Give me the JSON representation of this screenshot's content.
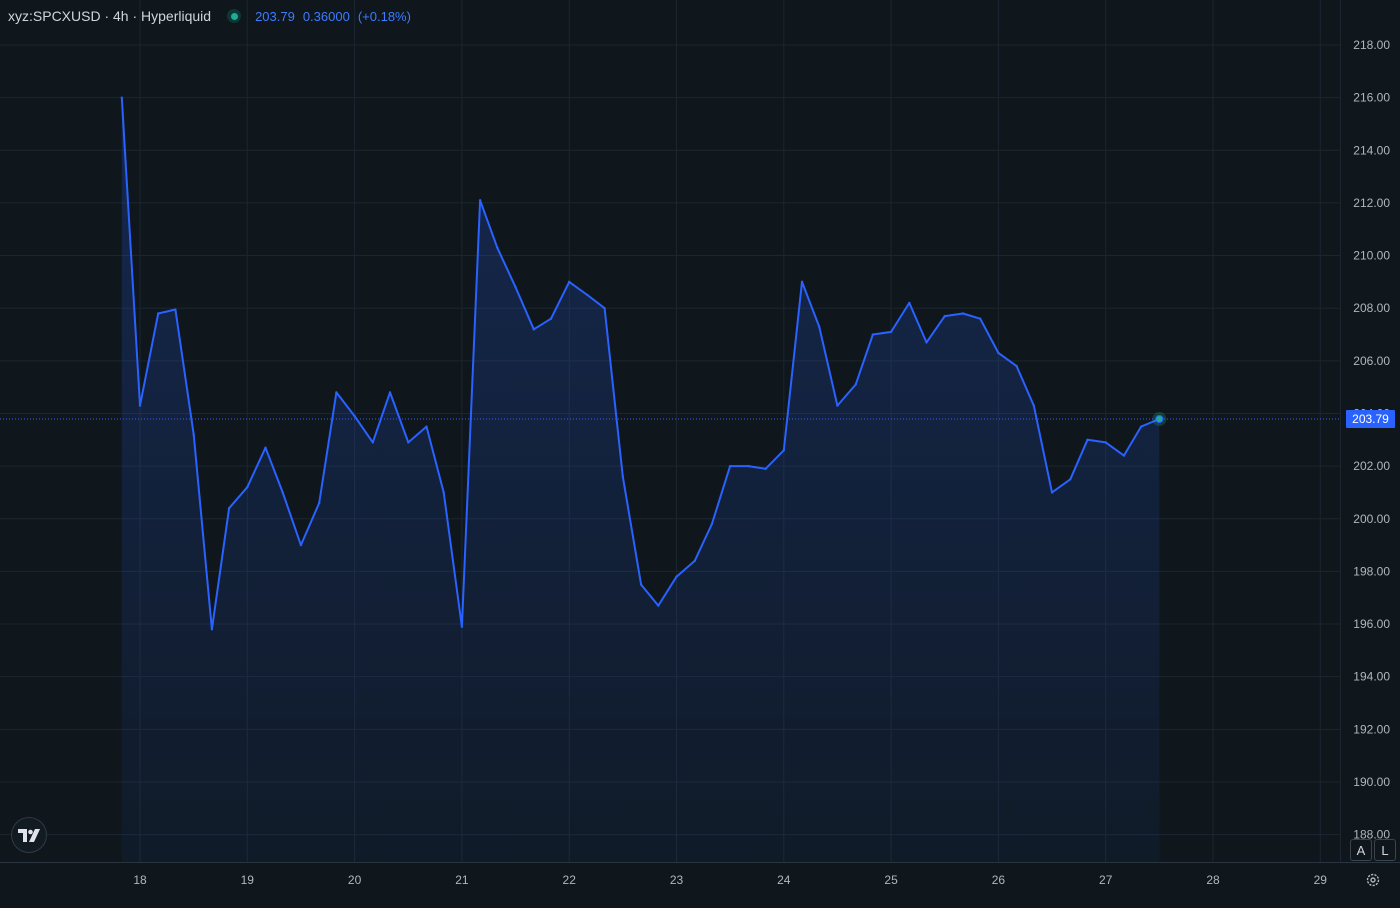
{
  "header": {
    "symbol": "xyz:SPCXUSD · 4h · Hyperliquid",
    "last": "203.79",
    "change": "0.36000",
    "change_pct": "(+0.18%)"
  },
  "price_label": "203.79",
  "buttons": {
    "auto": "A",
    "log": "L"
  },
  "icons": {
    "logo": "tradingview-logo-icon",
    "settings": "gear-icon",
    "status": "market-open-dot-icon"
  },
  "colors": {
    "background": "#0f171d",
    "line": "#2962ff",
    "grid": "#1b2630",
    "text": "#b2b5be",
    "price_tag": "#2962ff"
  },
  "chart_data": {
    "type": "area",
    "x_ticks": [
      "18",
      "19",
      "20",
      "21",
      "22",
      "23",
      "24",
      "25",
      "26",
      "27",
      "28",
      "29"
    ],
    "y_ticks": [
      "218.00",
      "216.00",
      "214.00",
      "212.00",
      "210.00",
      "208.00",
      "206.00",
      "204.00",
      "202.00",
      "200.00",
      "198.00",
      "196.00",
      "194.00",
      "192.00",
      "190.00",
      "188.00"
    ],
    "ylim": [
      188,
      219
    ],
    "xlim": [
      17,
      29.2
    ],
    "x_unit": "day of month (4h candles)",
    "last_price": 203.79,
    "series": [
      {
        "values": [
          [
            17.83,
            216.0
          ],
          [
            18.0,
            204.3
          ],
          [
            18.17,
            207.8
          ],
          [
            18.33,
            207.95
          ],
          [
            18.5,
            203.2
          ],
          [
            18.67,
            195.8
          ],
          [
            18.83,
            200.4
          ],
          [
            19.0,
            201.2
          ],
          [
            19.17,
            202.7
          ],
          [
            19.33,
            201.0
          ],
          [
            19.5,
            199.0
          ],
          [
            19.67,
            200.6
          ],
          [
            19.83,
            204.8
          ],
          [
            20.0,
            203.9
          ],
          [
            20.17,
            202.9
          ],
          [
            20.33,
            204.8
          ],
          [
            20.5,
            202.9
          ],
          [
            20.67,
            203.5
          ],
          [
            20.83,
            201.0
          ],
          [
            21.0,
            195.9
          ],
          [
            21.17,
            212.1
          ],
          [
            21.33,
            210.3
          ],
          [
            21.5,
            208.8
          ],
          [
            21.67,
            207.2
          ],
          [
            21.83,
            207.6
          ],
          [
            22.0,
            209.0
          ],
          [
            22.17,
            208.5
          ],
          [
            22.33,
            208.0
          ],
          [
            22.5,
            201.6
          ],
          [
            22.67,
            197.5
          ],
          [
            22.83,
            196.7
          ],
          [
            23.0,
            197.8
          ],
          [
            23.17,
            198.4
          ],
          [
            23.33,
            199.8
          ],
          [
            23.5,
            202.0
          ],
          [
            23.67,
            202.0
          ],
          [
            23.83,
            201.9
          ],
          [
            24.0,
            202.6
          ],
          [
            24.17,
            209.0
          ],
          [
            24.33,
            207.3
          ],
          [
            24.5,
            204.3
          ],
          [
            24.67,
            205.1
          ],
          [
            24.83,
            207.0
          ],
          [
            25.0,
            207.1
          ],
          [
            25.17,
            208.2
          ],
          [
            25.33,
            206.7
          ],
          [
            25.5,
            207.7
          ],
          [
            25.67,
            207.8
          ],
          [
            25.83,
            207.6
          ],
          [
            26.0,
            206.3
          ],
          [
            26.17,
            205.8
          ],
          [
            26.33,
            204.3
          ],
          [
            26.5,
            201.0
          ],
          [
            26.67,
            201.5
          ],
          [
            26.83,
            203.0
          ],
          [
            27.0,
            202.9
          ],
          [
            27.17,
            202.4
          ],
          [
            27.33,
            203.5
          ],
          [
            27.5,
            203.79
          ]
        ]
      }
    ]
  }
}
